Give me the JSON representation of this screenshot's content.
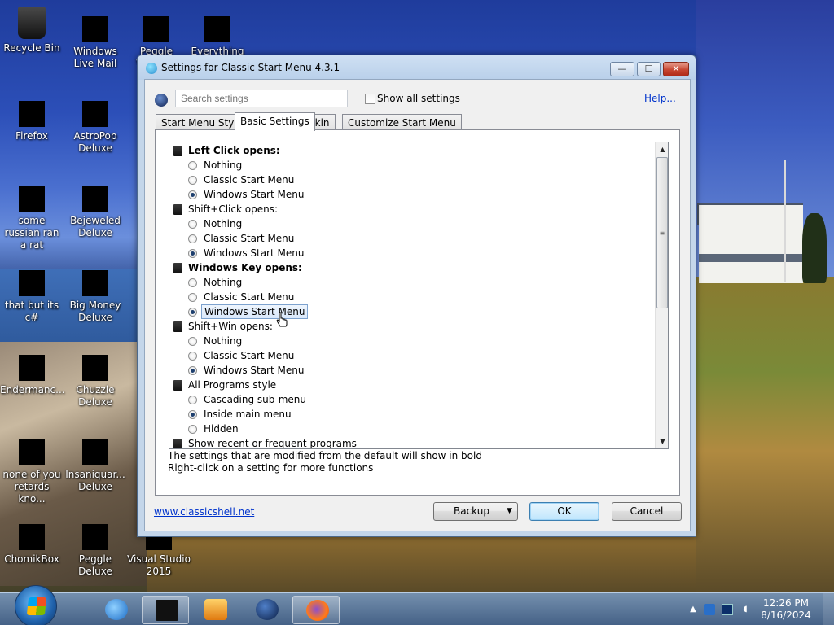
{
  "desktop": {
    "icons": [
      {
        "label": "Recycle Bin",
        "icon": "recycle-bin-icon"
      },
      {
        "label": "Windows Live Mail",
        "icon": "windows-live-mail-icon"
      },
      {
        "label": "Peggle World of",
        "icon": "peggle-world-icon"
      },
      {
        "label": "Everything",
        "icon": "everything-icon"
      },
      {
        "label": "Firefox",
        "icon": "firefox-icon"
      },
      {
        "label": "AstroPop Deluxe",
        "icon": "astropop-icon"
      },
      {
        "label": "some russian ran a rat",
        "icon": "file-icon"
      },
      {
        "label": "Bejeweled Deluxe",
        "icon": "bejeweled-icon"
      },
      {
        "label": "that but its c#",
        "icon": "file-icon"
      },
      {
        "label": "Big Money Deluxe",
        "icon": "big-money-icon"
      },
      {
        "label": "Endermanc...",
        "icon": "app-icon"
      },
      {
        "label": "Chuzzle Deluxe",
        "icon": "chuzzle-icon"
      },
      {
        "label": "none of you retards kno...",
        "icon": "file-icon"
      },
      {
        "label": "Insaniquar... Deluxe",
        "icon": "insaniquarium-icon"
      },
      {
        "label": "ChomikBox",
        "icon": "chomikbox-icon"
      },
      {
        "label": "Peggle Deluxe",
        "icon": "peggle-icon"
      },
      {
        "label": "Visual Studio 2015",
        "icon": "visual-studio-icon"
      }
    ]
  },
  "dialog": {
    "title": "Settings for Classic Start Menu 4.3.1",
    "window_buttons": {
      "minimize": "—",
      "maximize": "☐",
      "close": "✕"
    },
    "search": {
      "placeholder": "Search settings"
    },
    "show_all": {
      "label": "Show all settings",
      "checked": false
    },
    "help_link": "Help...",
    "tabs": [
      {
        "label": "Start Menu Style",
        "active": false
      },
      {
        "label": "Basic Settings",
        "active": true
      },
      {
        "label": "Skin",
        "active": false
      },
      {
        "label": "Customize Start Menu",
        "active": false
      }
    ],
    "settings": [
      {
        "type": "header",
        "label": "Left Click opens:",
        "bold": true
      },
      {
        "type": "option",
        "label": "Nothing",
        "selected": false
      },
      {
        "type": "option",
        "label": "Classic Start Menu",
        "selected": false
      },
      {
        "type": "option",
        "label": "Windows Start Menu",
        "selected": true
      },
      {
        "type": "header",
        "label": "Shift+Click opens:",
        "bold": false
      },
      {
        "type": "option",
        "label": "Nothing",
        "selected": false
      },
      {
        "type": "option",
        "label": "Classic Start Menu",
        "selected": false
      },
      {
        "type": "option",
        "label": "Windows Start Menu",
        "selected": true
      },
      {
        "type": "header",
        "label": "Windows Key opens:",
        "bold": true
      },
      {
        "type": "option",
        "label": "Nothing",
        "selected": false
      },
      {
        "type": "option",
        "label": "Classic Start Menu",
        "selected": false
      },
      {
        "type": "option",
        "label": "Windows Start Menu",
        "selected": true,
        "focused": true
      },
      {
        "type": "header",
        "label": "Shift+Win opens:",
        "bold": false
      },
      {
        "type": "option",
        "label": "Nothing",
        "selected": false
      },
      {
        "type": "option",
        "label": "Classic Start Menu",
        "selected": false
      },
      {
        "type": "option",
        "label": "Windows Start Menu",
        "selected": true
      },
      {
        "type": "header",
        "label": "All Programs style",
        "bold": false
      },
      {
        "type": "option",
        "label": "Cascading sub-menu",
        "selected": false
      },
      {
        "type": "option",
        "label": "Inside main menu",
        "selected": true
      },
      {
        "type": "option",
        "label": "Hidden",
        "selected": false
      },
      {
        "type": "header",
        "label": "Show recent or frequent programs",
        "bold": false
      }
    ],
    "note_line1": "The settings that are modified from the default will show in bold",
    "note_line2": "Right-click on a setting for more functions",
    "website_link": "www.classicshell.net",
    "buttons": {
      "backup": "Backup",
      "ok": "OK",
      "cancel": "Cancel"
    }
  },
  "taskbar": {
    "apps": [
      {
        "name": "internet-explorer-icon",
        "active": false
      },
      {
        "name": "command-prompt-icon",
        "active": true
      },
      {
        "name": "media-player-icon",
        "active": false
      },
      {
        "name": "classic-shell-icon",
        "active": false
      },
      {
        "name": "firefox-icon",
        "active": true
      }
    ],
    "time": "12:26 PM",
    "date": "8/16/2024"
  }
}
